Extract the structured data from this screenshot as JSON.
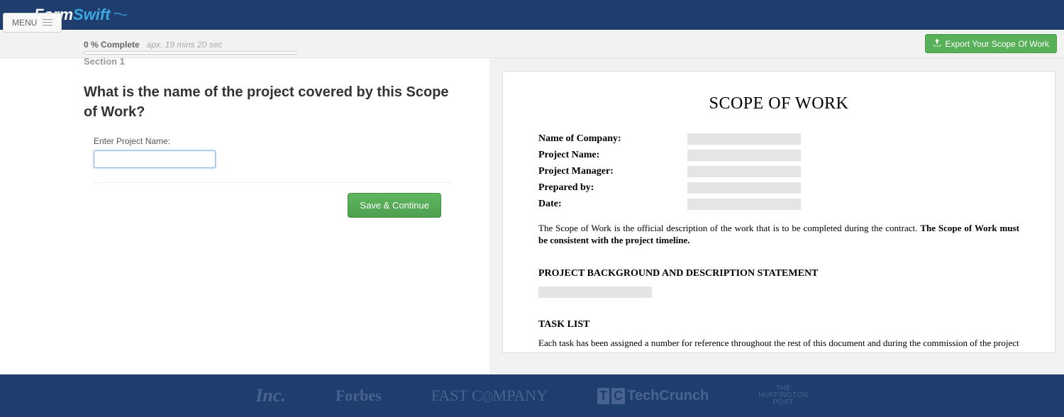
{
  "brand": {
    "part1": "Form",
    "part2": "Swift"
  },
  "menu_label": "MENU",
  "export_label": "Export Your Scope Of Work",
  "progress": {
    "pct_text": "0 % Complete",
    "eta_text": "apx. 19 mins 20 sec"
  },
  "section_label": "Section 1",
  "question_text": "What is the name of the project covered by this Scope of Work?",
  "field_label": "Enter Project Name:",
  "field_value": "",
  "save_label": "Save & Continue",
  "doc": {
    "title": "SCOPE OF WORK",
    "rows": [
      "Name of Company:",
      "Project Name:",
      "Project Manager:",
      "Prepared by:",
      "Date:"
    ],
    "intro_plain": "The Scope of Work is the official description of the work that is to be completed during the contract. ",
    "intro_bold": "The Scope of Work must be consistent with the project timeline.",
    "h2a": "PROJECT BACKGROUND AND DESCRIPTION STATEMENT",
    "h2b": "TASK LIST",
    "task_intro": "Each task has been assigned a number for reference throughout the rest of this document and during the commission of the project"
  },
  "footer": {
    "inc": "Inc.",
    "forbes": "Forbes",
    "fast": "FAST C",
    "fast2": "MPANY",
    "tc_prefix": "T",
    "tc_prefix2": "C",
    "tc": "TechCrunch",
    "huff1": "THE",
    "huff2": "HUFFINGTON",
    "huff3": "POST"
  }
}
